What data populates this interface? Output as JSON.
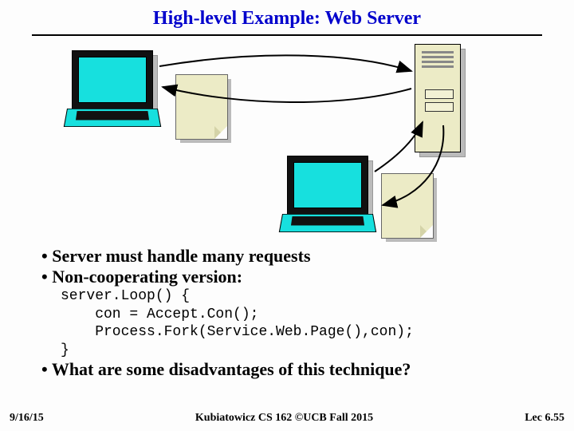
{
  "title": "High-level Example: Web Server",
  "bullets": {
    "b1": "Server must handle many requests",
    "b2": "Non-cooperating version:",
    "b3": "What are some disadvantages of this technique?"
  },
  "code": "server.Loop() {\n    con = Accept.Con();\n    Process.Fork(Service.Web.Page(),con);\n}",
  "footer": {
    "left": "9/16/15",
    "center": "Kubiatowicz CS 162 ©UCB Fall 2015",
    "right": "Lec 6.55"
  }
}
